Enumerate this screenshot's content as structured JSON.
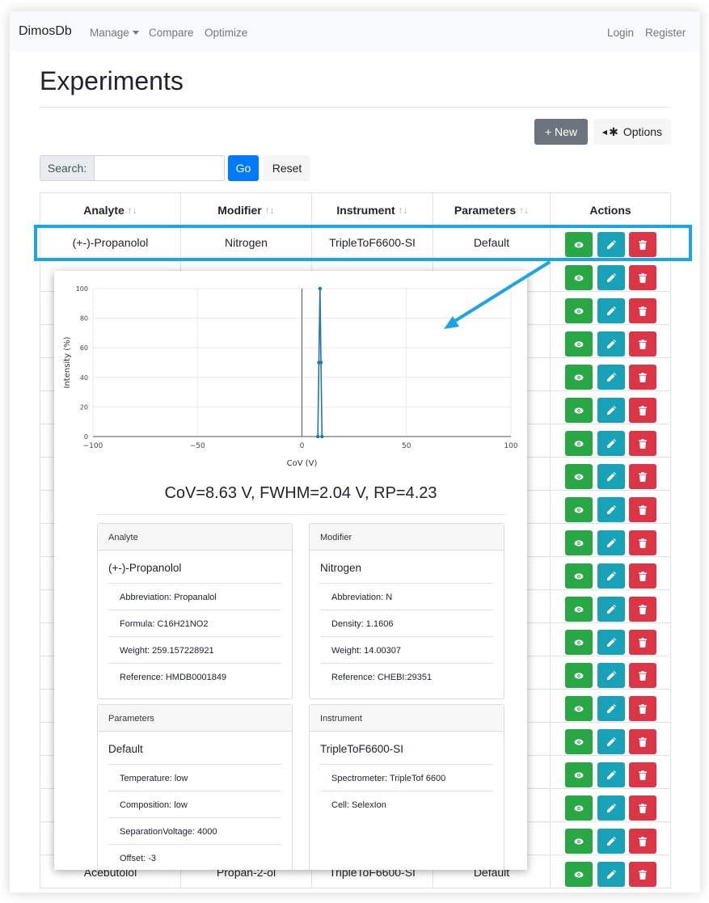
{
  "navbar": {
    "brand": "DimosDb",
    "links": {
      "manage": "Manage",
      "compare": "Compare",
      "optimize": "Optimize",
      "login": "Login",
      "register": "Register"
    }
  },
  "page": {
    "title": "Experiments",
    "new_button": "+ New",
    "options_button": "Options",
    "search_label": "Search:",
    "search_value": "",
    "go_button": "Go",
    "reset_button": "Reset"
  },
  "table": {
    "headers": [
      "Analyte",
      "Modifier",
      "Instrument",
      "Parameters",
      "Actions"
    ],
    "sort_glyph": "↑↓",
    "rows": [
      {
        "analyte": "(+-)-Propanolol",
        "modifier": "Nitrogen",
        "instrument": "TripleToF6600-SI",
        "parameters": "Default"
      },
      {
        "analyte": "Acebutolol",
        "modifier": "Propan-2-ol",
        "instrument": "TripleToF6600-SI",
        "parameters": "Default"
      }
    ],
    "action_row_count": 20
  },
  "popup": {
    "stats": "CoV=8.63 V, FWHM=2.04 V, RP=4.23",
    "cards": [
      {
        "header": "Analyte",
        "name": "(+-)-Propanolol",
        "items": [
          "Abbreviation: Propanalol",
          "Formula: C16H21NO2",
          "Weight: 259.157228921",
          "Reference: HMDB0001849"
        ]
      },
      {
        "header": "Modifier",
        "name": "Nitrogen",
        "items": [
          "Abbreviation: N",
          "Density: 1.1606",
          "Weight: 14.00307",
          "Reference: CHEBI:29351"
        ]
      },
      {
        "header": "Parameters",
        "name": "Default",
        "items": [
          "Temperature: low",
          "Composition: low",
          "SeparationVoltage: 4000",
          "Offset: -3"
        ]
      },
      {
        "header": "Instrument",
        "name": "TripleToF6600-SI",
        "items": [
          "Spectrometer: TripleTof 6600",
          "Cell: SelexIon"
        ]
      }
    ]
  },
  "chart_data": {
    "type": "line",
    "xlabel": "CoV (V)",
    "ylabel": "Intensity (%)",
    "xlim": [
      -100,
      100
    ],
    "ylim": [
      0,
      100
    ],
    "x_ticks": [
      "−100",
      "−50",
      "0",
      "50",
      "100"
    ],
    "y_ticks": [
      "0",
      "20",
      "40",
      "60",
      "80",
      "100"
    ],
    "grid": true,
    "series": [
      {
        "x": [
          7.6,
          8.1,
          8.63,
          9.1,
          9.6
        ],
        "y": [
          0,
          50,
          100,
          50,
          0
        ]
      }
    ]
  },
  "colors": {
    "highlight": "#1aa5e6",
    "view": "#28a745",
    "edit": "#17a2b8",
    "delete": "#dc3545",
    "primary": "#007bff",
    "series": "#1f77b4"
  },
  "icons": {
    "view": "eye-icon",
    "edit": "pencil-icon",
    "delete": "trash-icon",
    "options": "gear-icon",
    "manage": "caret-down-icon"
  }
}
